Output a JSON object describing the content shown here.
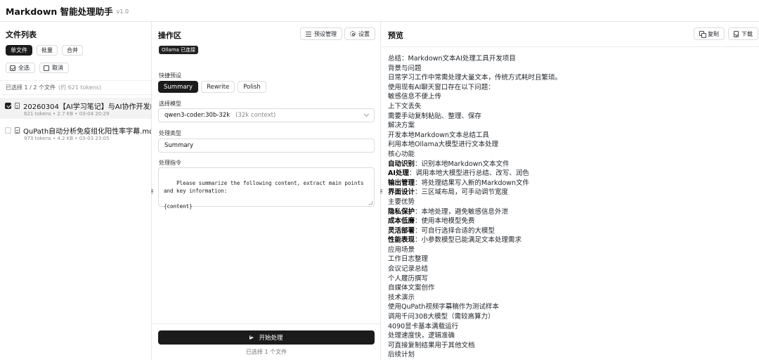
{
  "app": {
    "title": "Markdown 智能处理助手",
    "version": "v1.0"
  },
  "left": {
    "title": "文件列表",
    "modes": [
      "单文件",
      "批量",
      "合并"
    ],
    "select_all": "全选",
    "cancel": "取消",
    "status": "已选择 1 / 2 个文件",
    "status_tokens": "(约 621 tokens)",
    "files": [
      {
        "name": "20260304【AI学习笔记】与AI协作开发Markdown",
        "meta": "621 tokens  •  2.7 KB  •  03-04 20:29",
        "checked": true
      },
      {
        "name": "QuPath自动分析免疫组化阳性率字幕.md",
        "meta": "973 tokens  •  4.2 KB  •  03-03 23:05",
        "checked": false
      }
    ]
  },
  "mid": {
    "title": "操作区",
    "preset_manage": "预设管理",
    "settings": "设置",
    "ollama_status": "Ollama 已连接",
    "quick_presets_label": "快捷预设",
    "presets": [
      "Summary",
      "Rewrite",
      "Polish"
    ],
    "model_label": "选择模型",
    "model_value": "qwen3-coder:30b-32k",
    "model_context": "(32k context)",
    "type_label": "处理类型",
    "type_value": "Summary",
    "instruction_label": "处理指令",
    "instruction_text": "Please summarize the following content, extract main points\nand key information:\n\n{content}",
    "start_button": "开始处理",
    "start_hint": "已选择 1 个文件"
  },
  "right": {
    "title": "预览",
    "copy": "复制",
    "download": "下载",
    "lines": [
      {
        "text": "总结：Markdown文本AI处理工具开发项目"
      },
      {
        "text": "背景与问题"
      },
      {
        "text": "日常学习工作中常需处理大量文本，传统方式耗时且繁琐。"
      },
      {
        "text": "使用现有AI聊天窗口存在以下问题："
      },
      {
        "text": "敏感信息不便上传"
      },
      {
        "text": "上下文丢失"
      },
      {
        "text": "需要手动复制粘贴、整理、保存"
      },
      {
        "text": "解决方案"
      },
      {
        "text": "开发本地Markdown文本总结工具"
      },
      {
        "text": "利用本地Ollama大模型进行文本处理"
      },
      {
        "text": "核心功能"
      },
      {
        "bold": "自动识别",
        "text": "：识别本地Markdown文本文件"
      },
      {
        "bold": "AI处理",
        "text": "：调用本地大模型进行总结、改写、润色"
      },
      {
        "bold": "输出管理",
        "text": "：将处理结果写入新的Markdown文件"
      },
      {
        "bold": "界面设计",
        "text": "：三区域布局，可手动调节宽度"
      },
      {
        "text": "主要优势"
      },
      {
        "bold": "隐私保护",
        "text": "：本地处理，避免敏感信息外泄"
      },
      {
        "bold": "成本低廉",
        "text": "：使用本地模型免费"
      },
      {
        "bold": "灵活部署",
        "text": "：可自行选择合适的大模型"
      },
      {
        "bold": "性能表现",
        "text": "：小参数模型已能满足文本处理需求"
      },
      {
        "text": "应用场景"
      },
      {
        "text": "工作日志整理"
      },
      {
        "text": "会议记录总结"
      },
      {
        "text": "个人履历撰写"
      },
      {
        "text": "自媒体文案创作"
      },
      {
        "text": "技术演示"
      },
      {
        "text": "使用QuPath视频字幕稿作为测试样本"
      },
      {
        "text": "调用千问30B大模型（需较高算力）"
      },
      {
        "text": "4090显卡基本满载运行"
      },
      {
        "text": "处理速度快，逻辑准确"
      },
      {
        "text": "可直接复制结果用于其他文档"
      },
      {
        "text": "后续计划"
      }
    ]
  }
}
